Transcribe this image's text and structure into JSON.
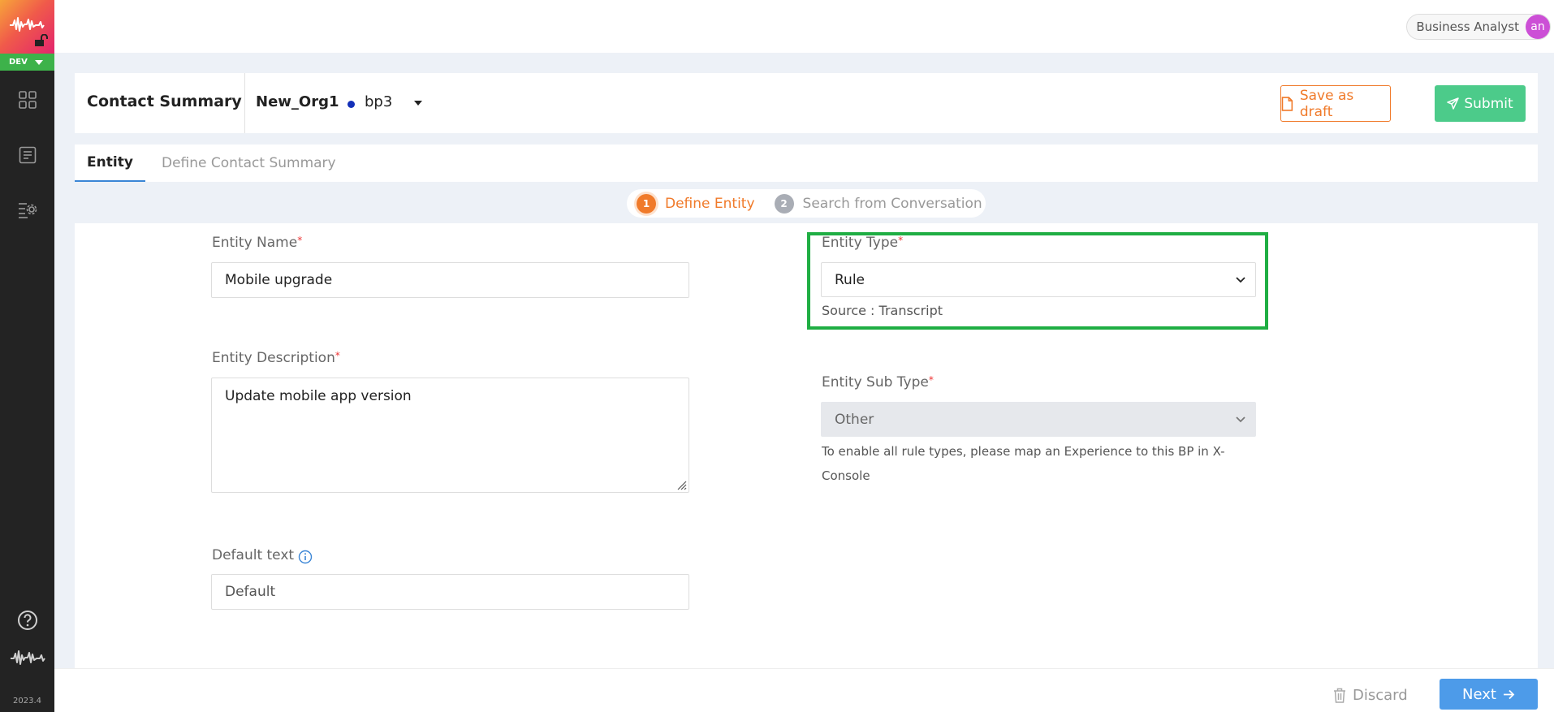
{
  "app": {
    "env_label": "DEV",
    "version": "2023.4"
  },
  "user": {
    "role": "Business Analyst",
    "initials": "an"
  },
  "header": {
    "title": "Contact Summary",
    "org": "New_Org1",
    "bp": "bp3",
    "save_draft_label": "Save as draft",
    "submit_label": "Submit"
  },
  "tabs": [
    {
      "label": "Entity",
      "active": true
    },
    {
      "label": "Define Contact Summary",
      "active": false
    }
  ],
  "stepper": [
    {
      "num": "1",
      "label": "Define Entity",
      "active": true
    },
    {
      "num": "2",
      "label": "Search from Conversation",
      "active": false
    }
  ],
  "form": {
    "entity_name": {
      "label": "Entity Name",
      "value": "Mobile upgrade"
    },
    "entity_description": {
      "label": "Entity Description",
      "value": "Update mobile app version"
    },
    "default_text": {
      "label": "Default text",
      "placeholder": "Default"
    },
    "entity_type": {
      "label": "Entity Type",
      "value": "Rule",
      "hint": "Source : Transcript"
    },
    "entity_sub_type": {
      "label": "Entity Sub Type",
      "value": "Other",
      "helper": "To enable all rule types, please map an Experience to this BP in X-Console"
    }
  },
  "footer": {
    "discard_label": "Discard",
    "next_label": "Next"
  },
  "colors": {
    "accent_orange": "#f07a2a",
    "submit_green": "#4ccb8a",
    "next_blue": "#4d9be9",
    "highlight_green": "#1fae43"
  }
}
